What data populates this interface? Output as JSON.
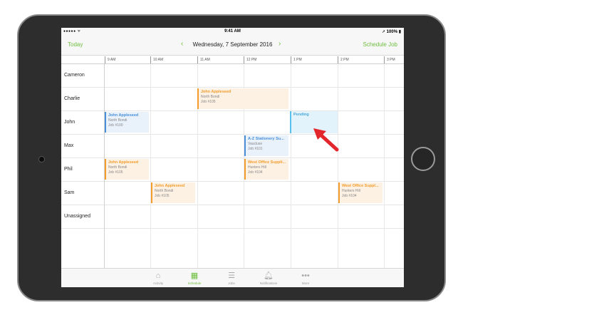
{
  "status_bar": {
    "signal": "●●●●● ᯤ",
    "time": "9:41 AM",
    "battery": "➚ 100% ▮"
  },
  "nav": {
    "today_label": "Today",
    "date": "Wednesday, 7 September 2016",
    "prev_icon": "‹",
    "next_icon": "›",
    "schedule_label": "Schedule Job"
  },
  "timeline": [
    "9 AM",
    "10 AM",
    "11 AM",
    "12 PM",
    "1 PM",
    "2 PM",
    "3 PM"
  ],
  "staff": [
    "Cameron",
    "Charlie",
    "John",
    "Max",
    "Phil",
    "Sam",
    "Unassigned"
  ],
  "jobs": [
    {
      "title": "John Appleseed",
      "suburb": "North Bondi",
      "job": "Job #105",
      "color": "#f39c2b"
    },
    {
      "title": "John Appleseed",
      "suburb": "North Bondi",
      "job": "Job #100",
      "color": "#4a90d9"
    },
    {
      "title": "Pending",
      "color": "#5bc0f0"
    },
    {
      "title": "A-Z Stationery Su...",
      "suburb": "Vaucluse",
      "job": "Job #101",
      "color": "#4a90d9"
    },
    {
      "title": "John Appleseed",
      "suburb": "North Bondi",
      "job": "Job #105",
      "color": "#f39c2b"
    },
    {
      "title": "West Office Suppli...",
      "suburb": "Hunters Hill",
      "job": "Job #104",
      "color": "#f39c2b"
    },
    {
      "title": "John Appleseed",
      "suburb": "North Bondi",
      "job": "Job #105",
      "color": "#f39c2b"
    },
    {
      "title": "West Office Suppl...",
      "suburb": "Hunters Hill",
      "job": "Job #104",
      "color": "#f39c2b"
    }
  ],
  "tabs": [
    {
      "label": "Activity",
      "icon": "house-icon",
      "glyph": "⌂"
    },
    {
      "label": "Schedule",
      "icon": "calendar-icon",
      "glyph": "▦"
    },
    {
      "label": "Jobs",
      "icon": "list-icon",
      "glyph": "☰"
    },
    {
      "label": "Notifications",
      "icon": "bell-icon",
      "glyph": "🔔︎"
    },
    {
      "label": "More",
      "icon": "more-icon",
      "glyph": "•••"
    }
  ],
  "colors": {
    "accent": "#6dbf3f",
    "annotation_arrow": "#e3262b"
  }
}
